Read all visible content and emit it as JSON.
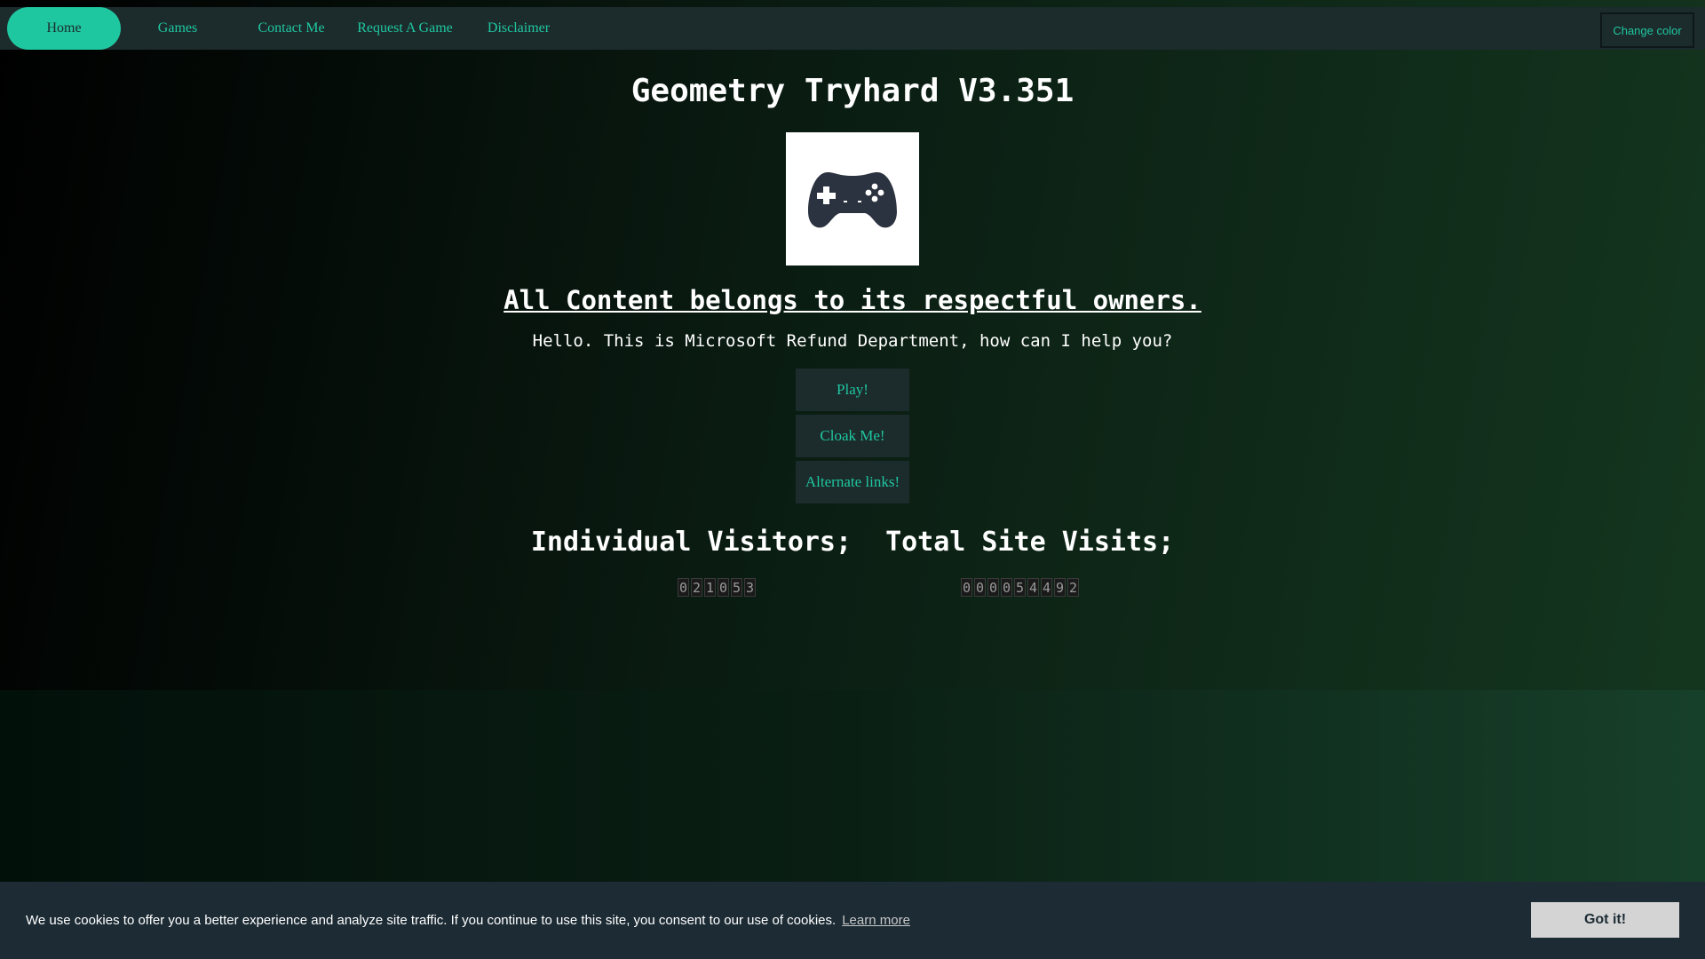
{
  "nav": {
    "items": [
      {
        "label": "Home",
        "active": true
      },
      {
        "label": "Games"
      },
      {
        "label": "Contact Me"
      },
      {
        "label": "Request A Game"
      },
      {
        "label": "Disclaimer"
      }
    ],
    "change_color_label": "Change color"
  },
  "main": {
    "title": "Geometry Tryhard V3.351",
    "logo_icon": "gamepad-icon",
    "owners_heading": "All Content belongs to its respectful owners.",
    "greeting": "Hello. This is Microsoft Refund Department, how can I help you?",
    "buttons": {
      "play": "Play!",
      "cloak": "Cloak Me!",
      "alternate": "Alternate links!"
    }
  },
  "stats": {
    "individual_label": "Individual Visitors;",
    "total_label": "Total Site Visits;",
    "individual_digits": "021053",
    "total_digits": "000054492"
  },
  "cookie": {
    "message": "We use cookies to offer you a better experience and analyze site traffic. If you continue to use this site, you consent to our use of cookies.",
    "learn_more": "Learn more",
    "accept": "Got it!"
  },
  "colors": {
    "accent": "#1fc7a0",
    "nav_bg": "#1c2b2c",
    "cookie_bg": "#1c2b34"
  }
}
